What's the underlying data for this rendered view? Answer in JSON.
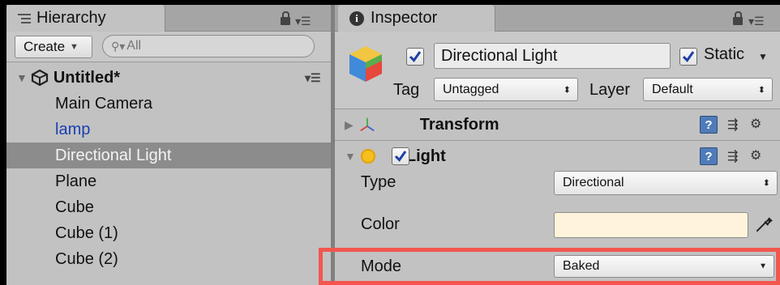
{
  "hierarchy": {
    "tab_label": "Hierarchy",
    "create_label": "Create",
    "search_placeholder": "All",
    "scene_name": "Untitled*",
    "items": [
      {
        "label": "Main Camera"
      },
      {
        "label": "lamp"
      },
      {
        "label": "Directional Light"
      },
      {
        "label": "Plane"
      },
      {
        "label": "Cube"
      },
      {
        "label": "Cube (1)"
      },
      {
        "label": "Cube (2)"
      }
    ],
    "selected_item": "Directional Light",
    "prefab_item": "lamp"
  },
  "inspector": {
    "tab_label": "Inspector",
    "object_name": "Directional Light",
    "active": true,
    "static_label": "Static",
    "static_checked": true,
    "tag_label": "Tag",
    "tag_value": "Untagged",
    "layer_label": "Layer",
    "layer_value": "Default",
    "components": {
      "transform": {
        "title": "Transform",
        "expanded": false
      },
      "light": {
        "title": "Light",
        "enabled": true,
        "expanded": true
      }
    },
    "properties": {
      "type": {
        "label": "Type",
        "value": "Directional"
      },
      "color": {
        "label": "Color",
        "value": "#fff4db"
      },
      "mode": {
        "label": "Mode",
        "value": "Baked"
      }
    }
  },
  "colors": {
    "highlight": "#f2564e",
    "selection": "#8c8c8c",
    "prefab_text": "#1a3fb4"
  }
}
